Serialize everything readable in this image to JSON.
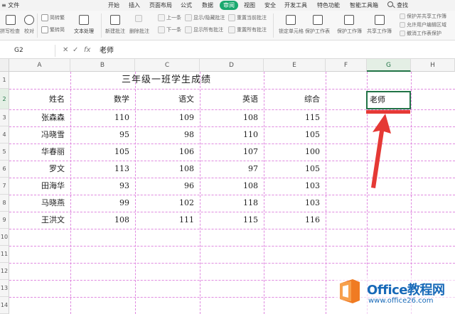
{
  "menubar": {
    "file": "≡ 文件",
    "items": [
      "开始",
      "插入",
      "页面布局",
      "公式",
      "数据",
      "审阅",
      "视图",
      "安全",
      "开发工具",
      "特色功能",
      "智能工具箱"
    ],
    "active": "审阅",
    "search": "查找"
  },
  "ribbon": {
    "spellcheck": "拼写检查",
    "proofread": "校对",
    "trad_simp_1": "简转繁",
    "trad_simp_2": "繁转简",
    "text_processing": "文本处理",
    "new_comment": "新建批注",
    "delete_comment": "删除批注",
    "prev": "上一条",
    "next": "下一条",
    "show_hide_comment": "显示/隐藏批注",
    "show_all_comments": "显示所有批注",
    "reset_current_comment": "重置当前批注",
    "reset_all_comments": "重置所有批注",
    "lock_cell": "锁定单元格",
    "protect_sheet": "保护工作表",
    "protect_workbook": "保护工作簿",
    "share_workbook": "共享工作簿",
    "protect_share_workbook": "保护并共享工作簿",
    "allow_edit_ranges": "允许用户编辑区域",
    "undo_protect": "撤消工作表保护"
  },
  "formula_bar": {
    "cell_ref": "G2",
    "fx": "fx",
    "content": "老师"
  },
  "columns": [
    "A",
    "B",
    "C",
    "D",
    "E",
    "F",
    "G",
    "H"
  ],
  "selected_column": "G",
  "rows": [
    "1",
    "2",
    "3",
    "4",
    "5",
    "6",
    "7",
    "8",
    "9",
    "10",
    "11",
    "12",
    "13",
    "14"
  ],
  "selected_row": "2",
  "sheet": {
    "title": "三年级一班学生成绩",
    "headers": [
      "姓名",
      "数学",
      "语文",
      "英语",
      "综合"
    ],
    "students": [
      [
        "张森森",
        "110",
        "109",
        "108",
        "115"
      ],
      [
        "冯晓雪",
        "95",
        "98",
        "110",
        "105"
      ],
      [
        "华春丽",
        "105",
        "106",
        "107",
        "100"
      ],
      [
        "罗文",
        "113",
        "108",
        "97",
        "105"
      ],
      [
        "田海华",
        "93",
        "96",
        "108",
        "103"
      ],
      [
        "马晓燕",
        "99",
        "102",
        "118",
        "103"
      ],
      [
        "王洪文",
        "108",
        "111",
        "115",
        "116"
      ]
    ],
    "active_cell_value": "老师"
  },
  "watermark": {
    "title": "Office教程网",
    "url": "www.office26.com"
  },
  "colors": {
    "accent_green": "#217346",
    "review_tab": "#1aa86e",
    "annotation_red": "#e53935",
    "gridline_pink": "#e08ae0",
    "watermark_blue": "#1769b8",
    "watermark_orange": "#f07b22"
  }
}
